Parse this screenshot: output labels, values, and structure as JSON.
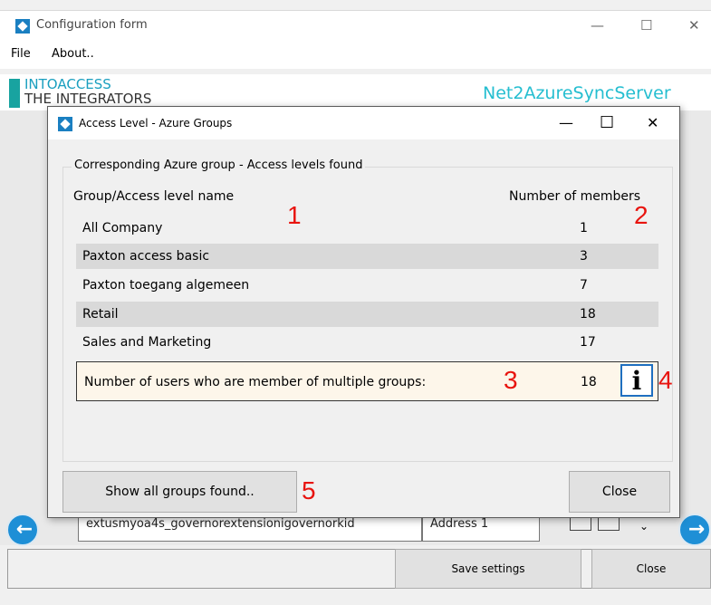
{
  "window": {
    "title": "Configuration form",
    "min": "—",
    "max": "☐",
    "close": "✕"
  },
  "menu": {
    "file": "File",
    "about": "About.."
  },
  "logo": {
    "line1": "INTOACCESS",
    "line2": "THE INTEGRATORS"
  },
  "app_name": "Net2AzureSyncServer",
  "background_fields": {
    "field_value": "extusmyoa4s_governorextensionigovernorkid",
    "address_label": "Address 1"
  },
  "bottom_bar": {
    "save": "Save settings",
    "close": "Close"
  },
  "nav": {
    "left": "←",
    "right": "→"
  },
  "dialog": {
    "title": "Access Level - Azure Groups",
    "min": "—",
    "max": "☐",
    "close": "✕",
    "groupbox_title": "Corresponding Azure group - Access levels found",
    "col_name": "Group/Access level name",
    "col_count": "Number of members",
    "rows": [
      {
        "name": "All Company",
        "count": "1"
      },
      {
        "name": "Paxton access basic",
        "count": "3"
      },
      {
        "name": "Paxton toegang algemeen",
        "count": "7"
      },
      {
        "name": "Retail",
        "count": "18"
      },
      {
        "name": "Sales and Marketing",
        "count": "17"
      }
    ],
    "multi_label": "Number of users who are member of multiple groups:",
    "multi_count": "18",
    "info_glyph": "i",
    "show_all_button": "Show all groups found..",
    "close_button": "Close"
  },
  "annotations": [
    "1",
    "2",
    "3",
    "4",
    "5"
  ],
  "colors": {
    "accent": "#1e8fd6",
    "annotation": "#e8140f",
    "highlight_box": "#fdf6ea"
  }
}
